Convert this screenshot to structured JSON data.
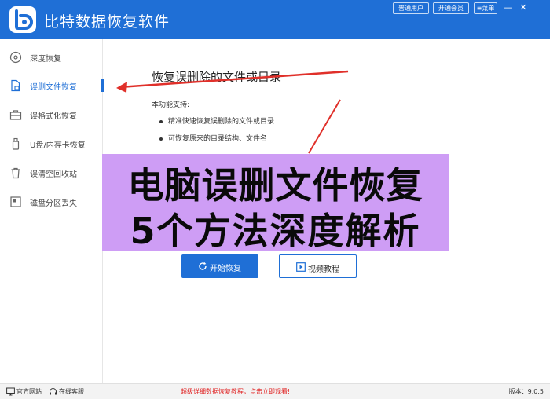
{
  "app": {
    "title": "比特数据恢复软件"
  },
  "titlebar": {
    "buttons": [
      "普通用户",
      "开通会员",
      "菜单"
    ],
    "minimize_glyph": "—",
    "close_glyph": "✕"
  },
  "sidebar": {
    "items": [
      {
        "label": "深度恢复",
        "icon": "disk-scan-icon"
      },
      {
        "label": "误删文件恢复",
        "icon": "file-lock-icon"
      },
      {
        "label": "误格式化恢复",
        "icon": "briefcase-icon"
      },
      {
        "label": "U盘/内存卡恢复",
        "icon": "usb-drive-icon"
      },
      {
        "label": "误清空回收站",
        "icon": "trash-icon"
      },
      {
        "label": "磁盘分区丢失",
        "icon": "partition-icon"
      }
    ],
    "active_index": 1
  },
  "main": {
    "title": "恢复误删除的文件或目录",
    "feature_heading": "本功能支持:",
    "features": [
      "精准快速恢复误删除的文件或目录",
      "可恢复原来的目录结构、文件名"
    ],
    "overlay_line1": "电脑误删文件恢复",
    "overlay_line2": "5个方法深度解析",
    "start_button": "开始恢复",
    "video_button": "视频教程"
  },
  "statusbar": {
    "website": "官方网站",
    "support": "在线客服",
    "promo": "超级详细数据恢复教程，点击立即观看!",
    "version": "版本：9.0.5"
  },
  "colors": {
    "accent": "#1f6fd6",
    "overlay": "#ce9df5",
    "arrow": "#e0302a",
    "promo": "#e02020"
  }
}
